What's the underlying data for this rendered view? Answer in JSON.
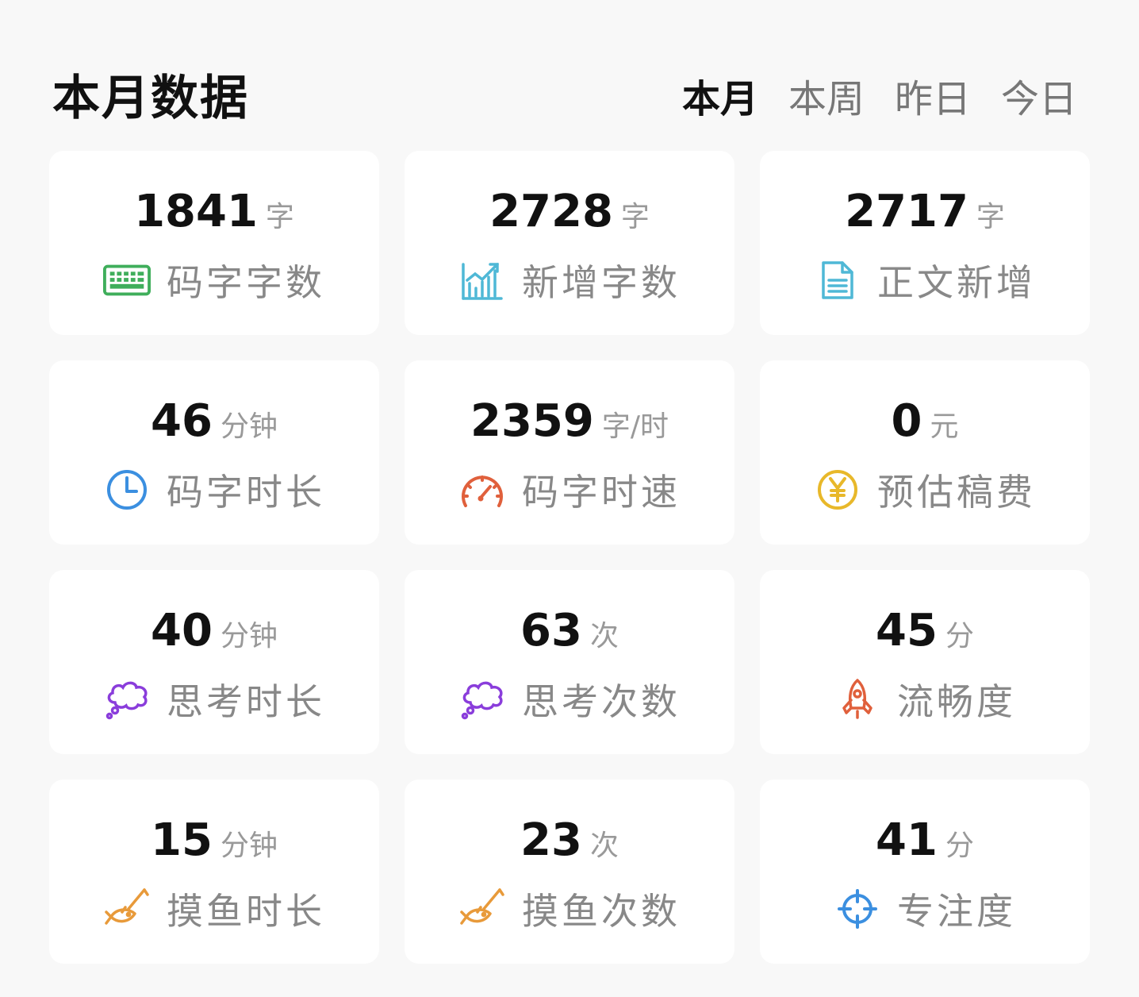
{
  "header": {
    "title": "本月数据",
    "tabs": [
      {
        "label": "本月",
        "active": true
      },
      {
        "label": "本周",
        "active": false
      },
      {
        "label": "昨日",
        "active": false
      },
      {
        "label": "今日",
        "active": false
      }
    ]
  },
  "cards": [
    {
      "value": "1841",
      "unit": "字",
      "label": "码字字数",
      "icon": "keyboard-icon",
      "color": "#3fae5b"
    },
    {
      "value": "2728",
      "unit": "字",
      "label": "新增字数",
      "icon": "chart-up-icon",
      "color": "#4fb8d6"
    },
    {
      "value": "2717",
      "unit": "字",
      "label": "正文新增",
      "icon": "document-icon",
      "color": "#4fb8d6"
    },
    {
      "value": "46",
      "unit": "分钟",
      "label": "码字时长",
      "icon": "clock-icon",
      "color": "#3b8fe0"
    },
    {
      "value": "2359",
      "unit": "字/时",
      "label": "码字时速",
      "icon": "speedometer-icon",
      "color": "#e0603c"
    },
    {
      "value": "0",
      "unit": "元",
      "label": "预估稿费",
      "icon": "yen-coin-icon",
      "color": "#e8b82a"
    },
    {
      "value": "40",
      "unit": "分钟",
      "label": "思考时长",
      "icon": "thought-bubble-icon",
      "color": "#8a3ddb"
    },
    {
      "value": "63",
      "unit": "次",
      "label": "思考次数",
      "icon": "thought-bubble-icon",
      "color": "#8a3ddb"
    },
    {
      "value": "45",
      "unit": "分",
      "label": "流畅度",
      "icon": "rocket-icon",
      "color": "#e0603c"
    },
    {
      "value": "15",
      "unit": "分钟",
      "label": "摸鱼时长",
      "icon": "fish-rod-icon",
      "color": "#e89a3a"
    },
    {
      "value": "23",
      "unit": "次",
      "label": "摸鱼次数",
      "icon": "fish-rod-icon",
      "color": "#e89a3a"
    },
    {
      "value": "41",
      "unit": "分",
      "label": "专注度",
      "icon": "crosshair-icon",
      "color": "#3b8fe0"
    }
  ]
}
